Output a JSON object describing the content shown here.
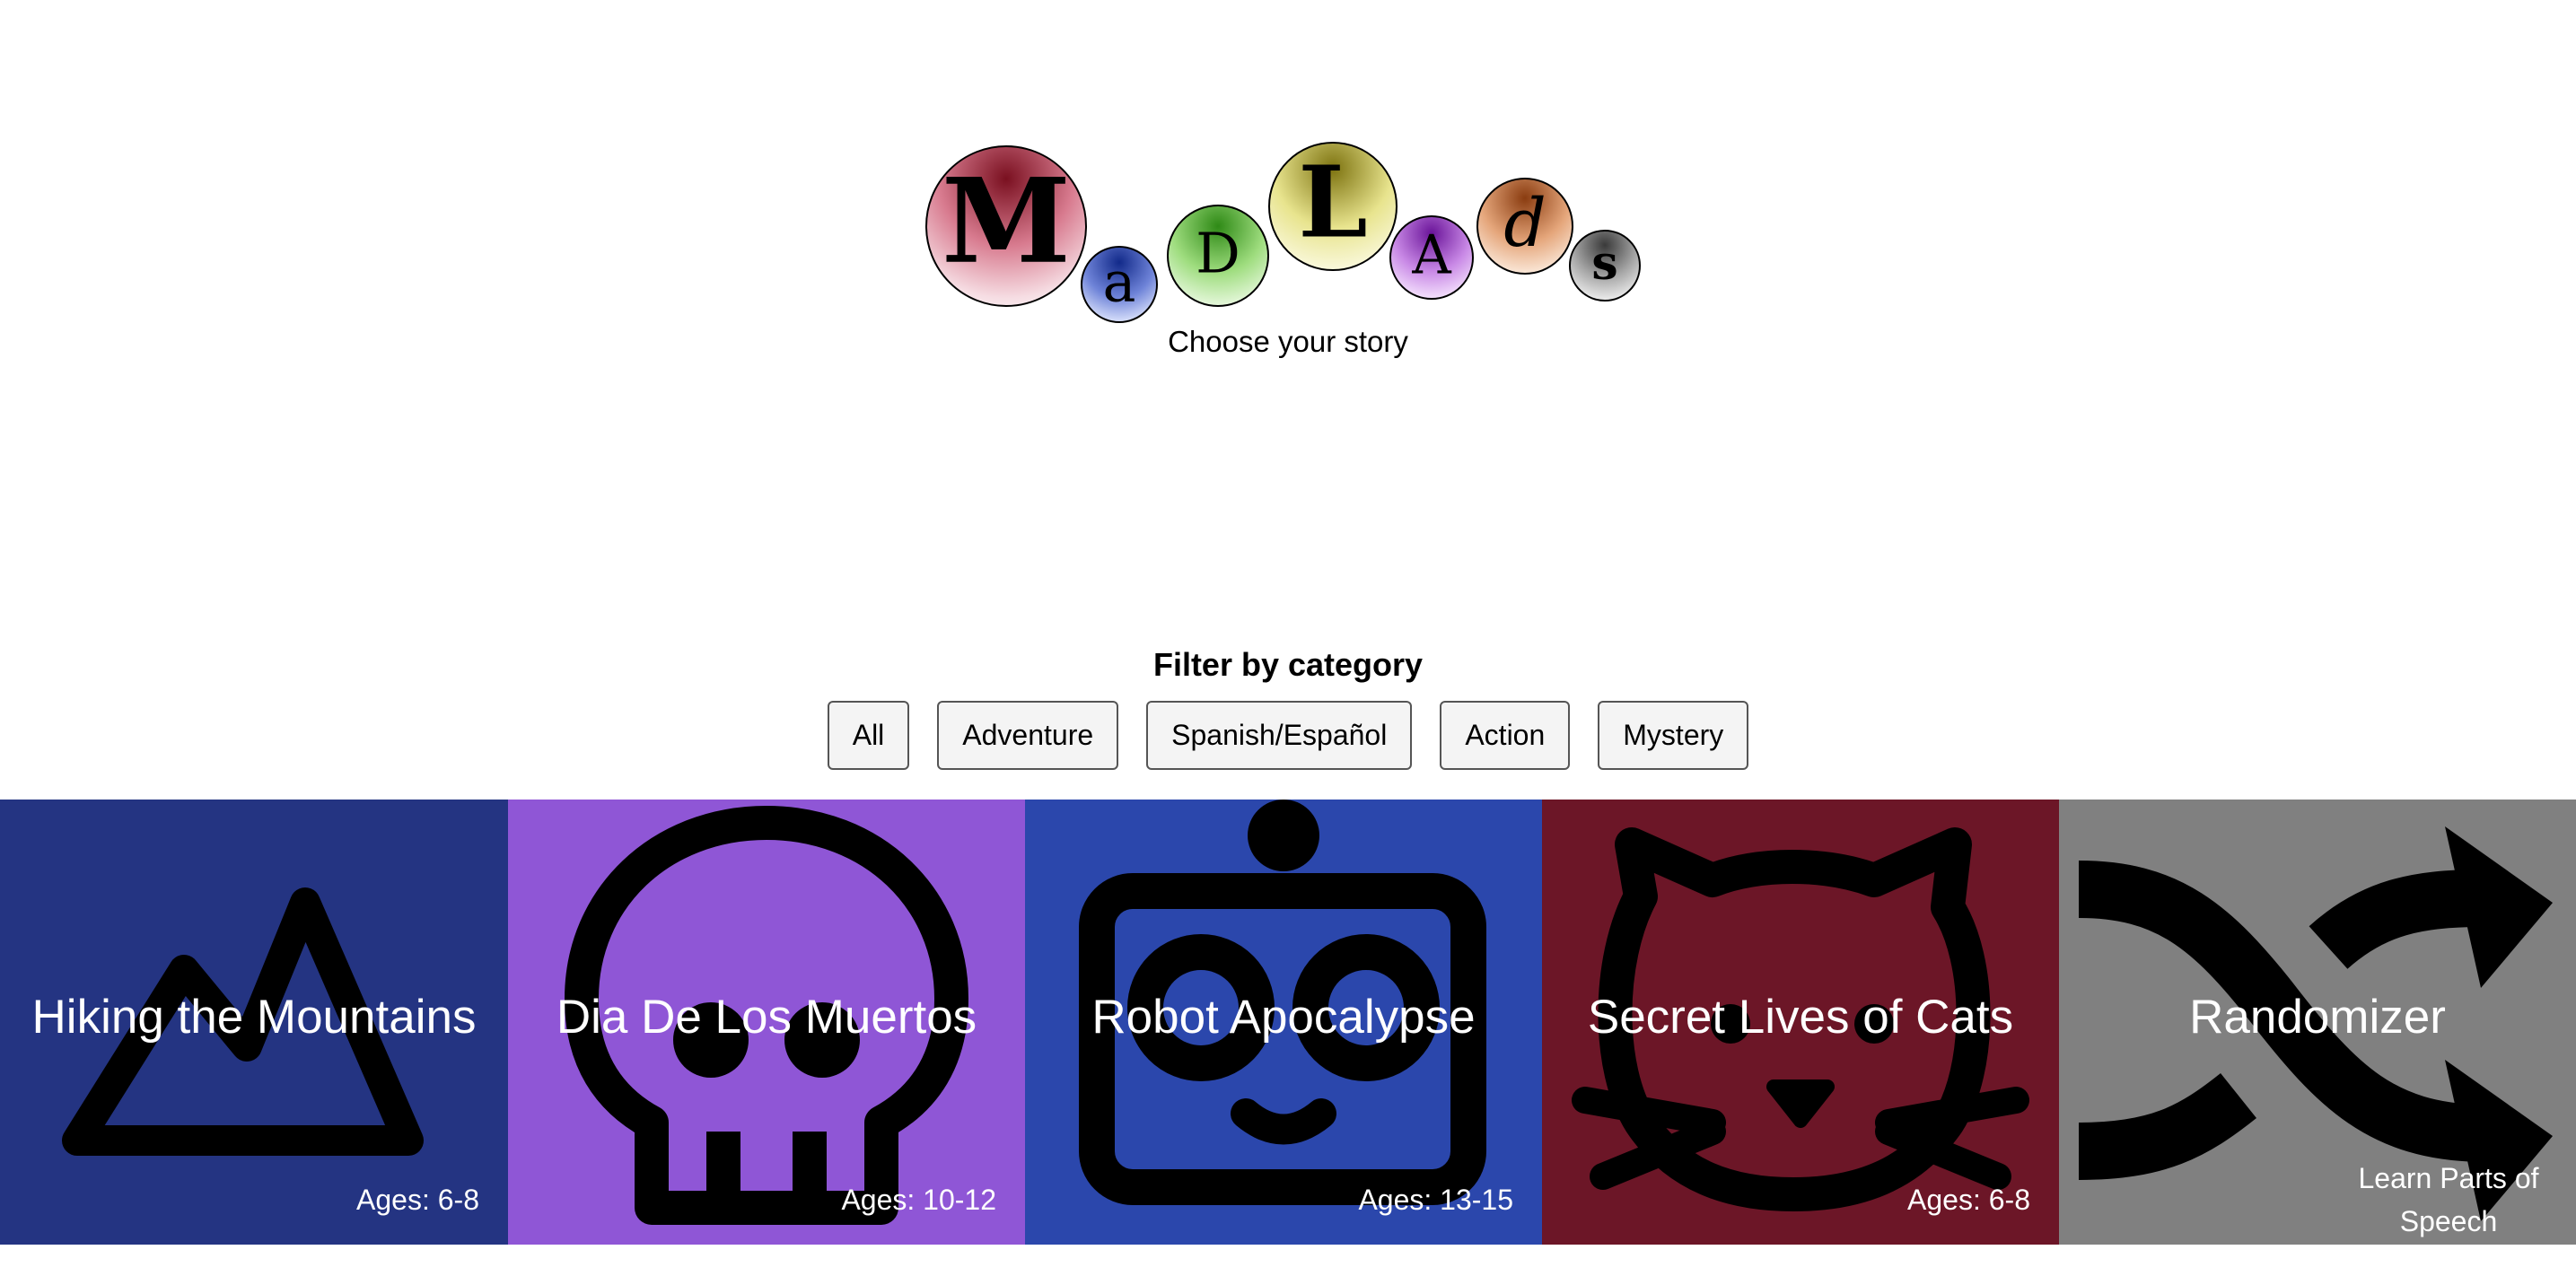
{
  "logo": {
    "letters": [
      "M",
      "a",
      "D",
      "L",
      "A",
      "d",
      "s"
    ]
  },
  "tagline": "Choose your story",
  "filter": {
    "heading": "Filter by category",
    "buttons": [
      "All",
      "Adventure",
      "Spanish/Español",
      "Action",
      "Mystery"
    ]
  },
  "cards": [
    {
      "title": "Hiking the Mountains",
      "age": "Ages: 6-8",
      "icon": "mountain-icon",
      "color": "#243482"
    },
    {
      "title": "Dia De Los Muertos",
      "age": "Ages: 10-12",
      "icon": "skull-icon",
      "color": "#8f56d6"
    },
    {
      "title": "Robot Apocalypse",
      "age": "Ages: 13-15",
      "icon": "robot-icon",
      "color": "#2b47ac"
    },
    {
      "title": "Secret Lives of Cats",
      "age": "Ages: 6-8",
      "icon": "cat-icon",
      "color": "#6c1627"
    },
    {
      "title": "Randomizer",
      "age": "Learn Parts of Speech",
      "icon": "shuffle-icon",
      "color": "#808080"
    }
  ]
}
